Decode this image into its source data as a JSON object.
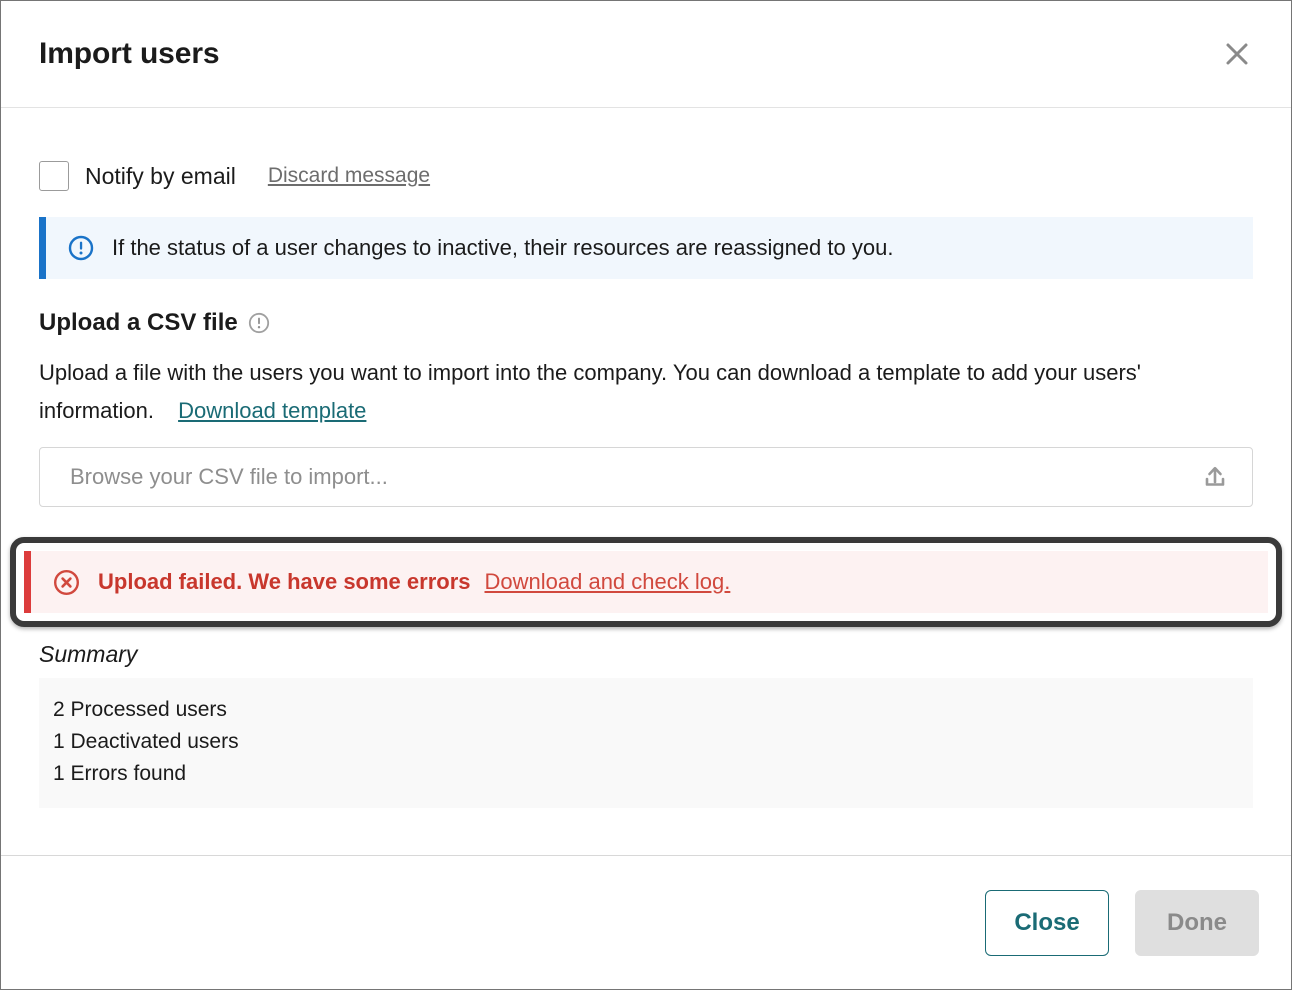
{
  "dialog": {
    "title": "Import users",
    "close_icon": "close-icon"
  },
  "notify": {
    "checkbox_label": "Notify by email",
    "checked": false,
    "discard_link": "Discard message"
  },
  "info_banner": {
    "icon": "info-circle-icon",
    "text": "If the status of a user changes to inactive, their resources are reassigned to you.",
    "accent_color": "#1a73c8",
    "background_color": "#f1f7fd"
  },
  "upload_section": {
    "heading": "Upload a CSV file",
    "help_icon": "help-circle-icon",
    "description": "Upload a file with the users you want to import into the company. You can download a template to add your users' information.",
    "template_link": "Download template",
    "file_placeholder": "Browse your CSV file to import...",
    "upload_icon": "upload-icon",
    "link_color": "#1a6b75"
  },
  "error_alert": {
    "icon": "error-circle-x-icon",
    "message": "Upload failed. We have some errors",
    "link": "Download and check log.",
    "accent_color": "#dc3c3c",
    "background_color": "#fdf2f2",
    "text_color": "#c8372d",
    "focused": true
  },
  "summary": {
    "title": "Summary",
    "lines": [
      "2 Processed users",
      "1 Deactivated users",
      "1 Errors found"
    ]
  },
  "footer": {
    "close_label": "Close",
    "done_label": "Done",
    "done_disabled": true
  }
}
